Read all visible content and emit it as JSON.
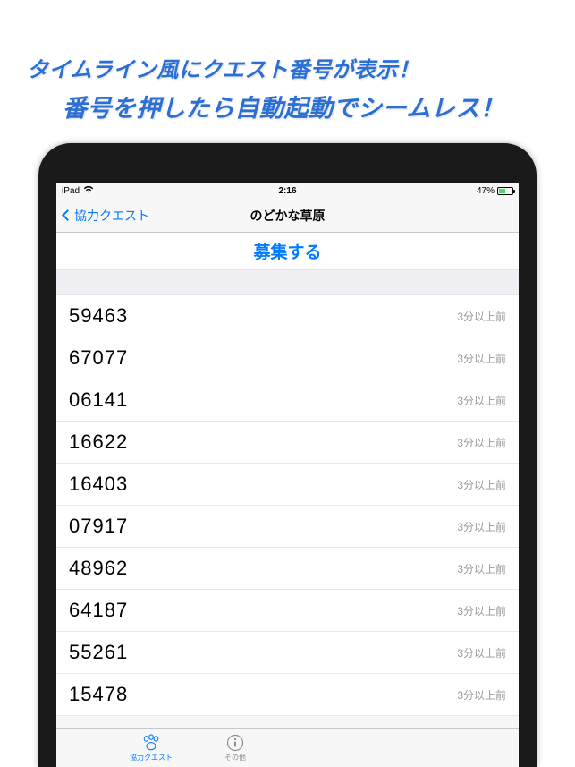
{
  "promo": {
    "line1": "タイムライン風にクエスト番号が表示！",
    "line2": "番号を押したら自動起動でシームレス！"
  },
  "status_bar": {
    "carrier": "iPad",
    "time": "2:16",
    "battery_pct": "47%"
  },
  "nav": {
    "back_label": "協力クエスト",
    "title": "のどかな草原"
  },
  "recruit": {
    "label": "募集する"
  },
  "quest_list": [
    {
      "number": "59463",
      "time": "3分以上前"
    },
    {
      "number": "67077",
      "time": "3分以上前"
    },
    {
      "number": "06141",
      "time": "3分以上前"
    },
    {
      "number": "16622",
      "time": "3分以上前"
    },
    {
      "number": "16403",
      "time": "3分以上前"
    },
    {
      "number": "07917",
      "time": "3分以上前"
    },
    {
      "number": "48962",
      "time": "3分以上前"
    },
    {
      "number": "64187",
      "time": "3分以上前"
    },
    {
      "number": "55261",
      "time": "3分以上前"
    },
    {
      "number": "15478",
      "time": "3分以上前"
    }
  ],
  "tabs": {
    "coop": "協力クエスト",
    "other": "その他"
  }
}
